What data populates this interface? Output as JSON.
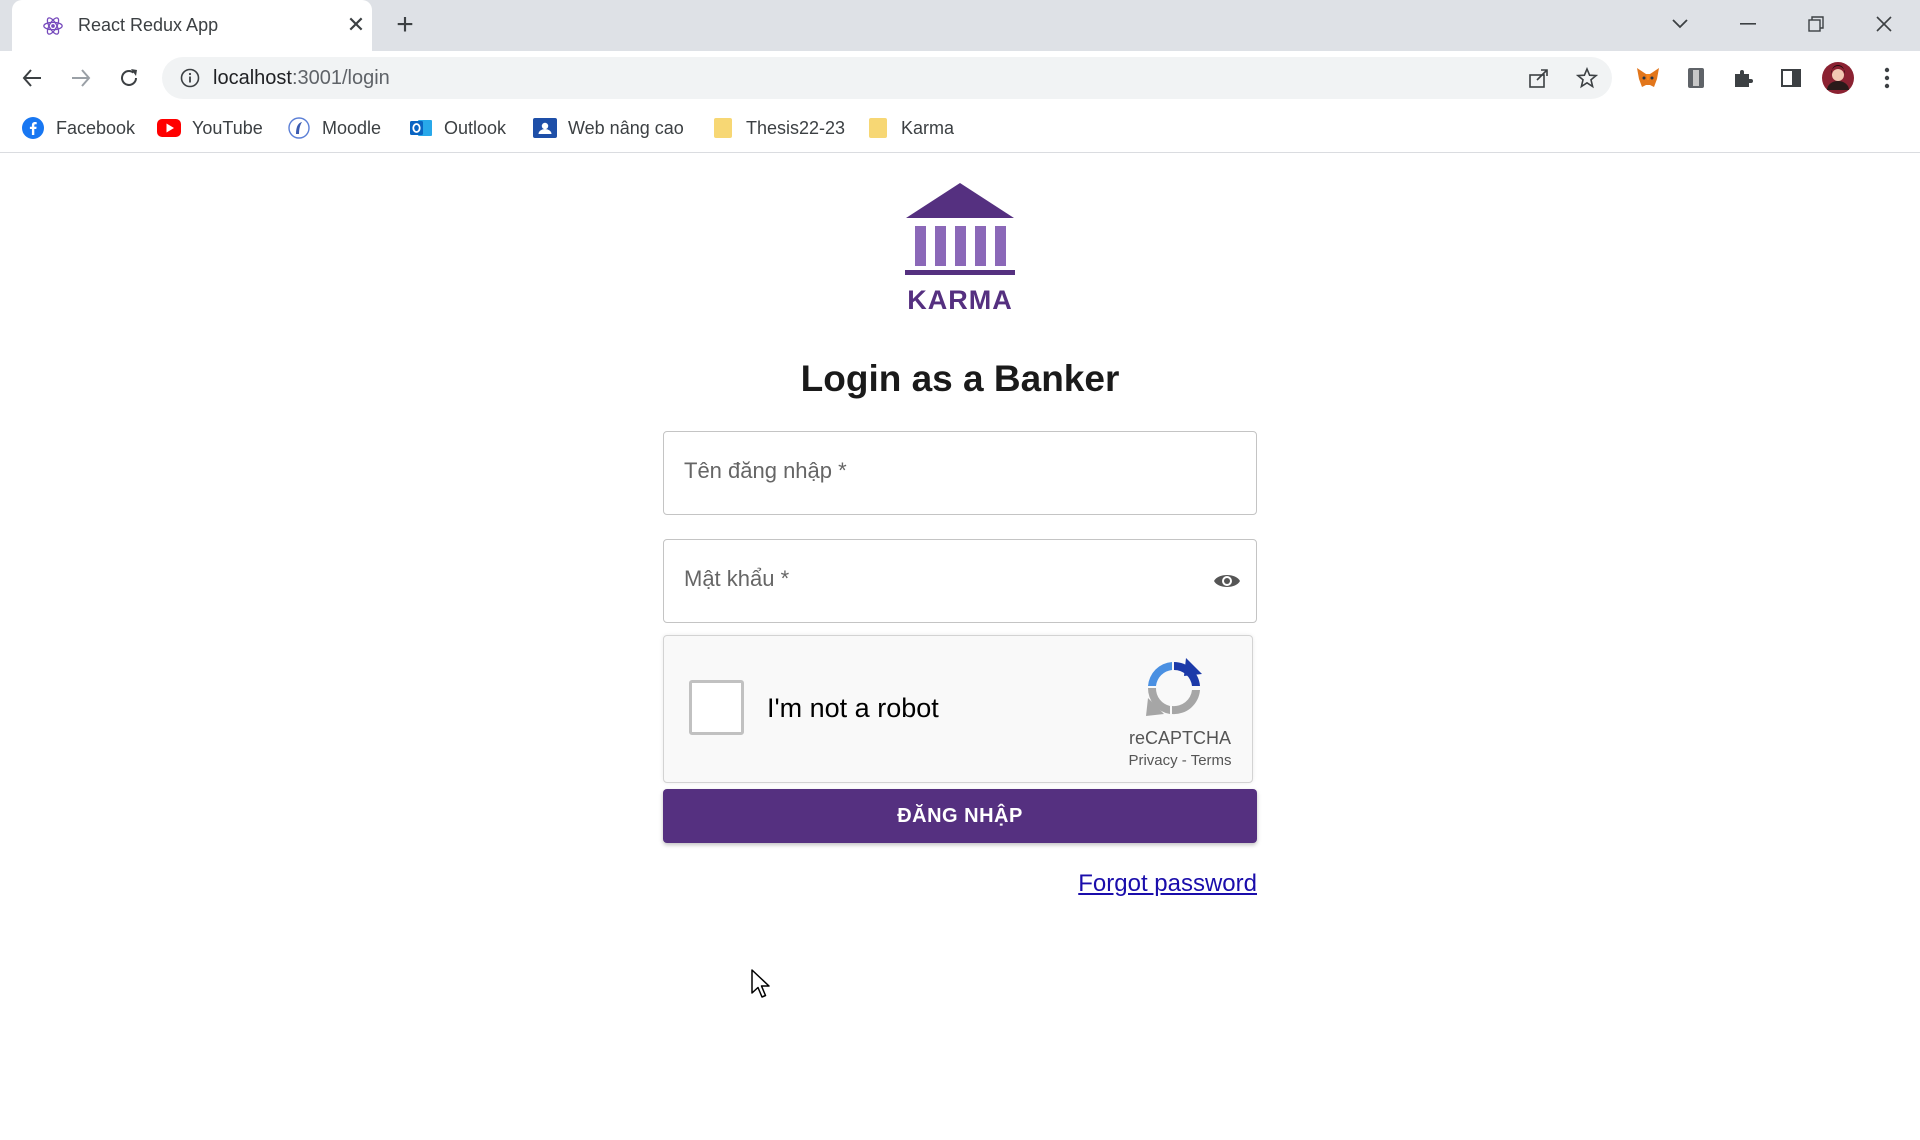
{
  "browser": {
    "tab_title": "React Redux App",
    "tab_close": "✕",
    "new_tab": "+",
    "url_host": "localhost",
    "url_path": ":3001/login",
    "bookmarks": [
      {
        "label": "Facebook",
        "icon": "facebook-icon",
        "color": "#1877f2"
      },
      {
        "label": "YouTube",
        "icon": "youtube-icon",
        "color": "#ff0000"
      },
      {
        "label": "Moodle",
        "icon": "moodle-icon",
        "color": "#5b7fd6"
      },
      {
        "label": "Outlook",
        "icon": "outlook-icon",
        "color": "#0a64c2"
      },
      {
        "label": "Web nâng cao",
        "icon": "classroom-icon",
        "color": "#1e4fa8"
      },
      {
        "label": "Thesis22-23",
        "icon": "folder-icon",
        "color": "#f7d774"
      },
      {
        "label": "Karma",
        "icon": "folder-icon",
        "color": "#f7d774"
      }
    ]
  },
  "page": {
    "logo_text": "KARMA",
    "title": "Login as a Banker",
    "username_label": "Tên đăng nhập *",
    "password_label": "Mật khẩu *",
    "login_button": "ĐĂNG NHẬP",
    "forgot_password": "Forgot password",
    "brand_color": "#553080"
  },
  "recaptcha": {
    "label": "I'm not a robot",
    "brand": "reCAPTCHA",
    "privacy": "Privacy",
    "separator": " - ",
    "terms": "Terms"
  }
}
